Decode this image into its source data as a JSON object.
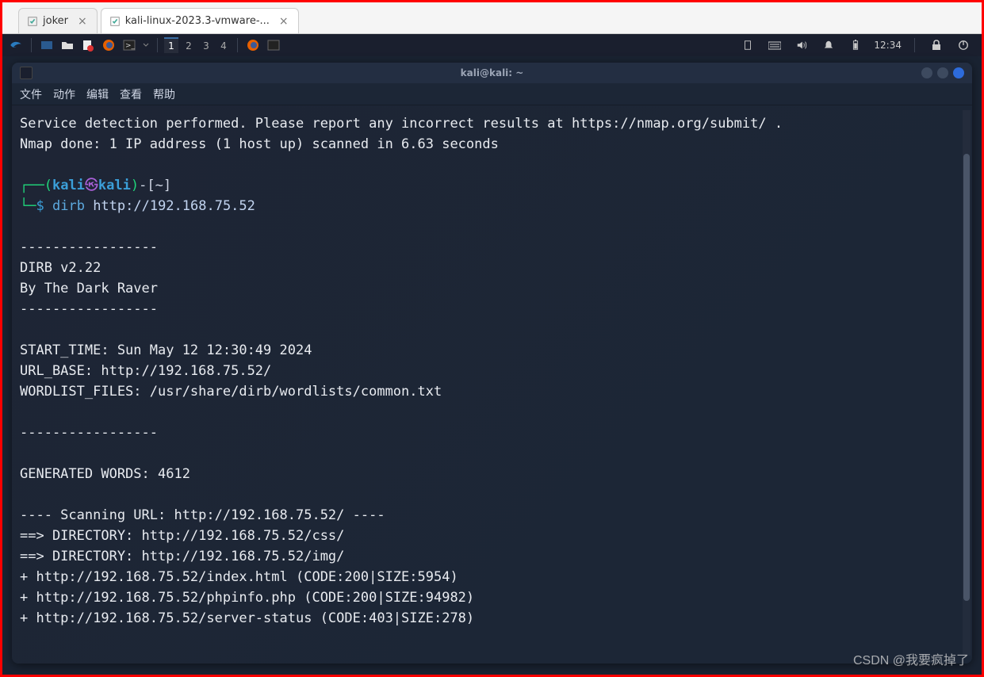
{
  "outer_tabs": [
    {
      "label": "joker",
      "active": false
    },
    {
      "label": "kali-linux-2023.3-vmware-...",
      "active": true
    }
  ],
  "taskbar": {
    "workspaces": [
      "1",
      "2",
      "3",
      "4"
    ],
    "active_workspace": 0,
    "clock": "12:34"
  },
  "terminal": {
    "title": "kali@kali: ~",
    "menu": {
      "file": "文件",
      "action": "动作",
      "edit": "编辑",
      "view": "查看",
      "help": "帮助"
    },
    "prompt": {
      "user": "kali",
      "host": "kali",
      "path": "~",
      "symbol": "$",
      "dash": "-",
      "l1": "┌──",
      "l2": "└─"
    },
    "command": {
      "name": "dirb",
      "arg": "http://192.168.75.52"
    },
    "lines": {
      "svc": "Service detection performed. Please report any incorrect results at https://nmap.org/submit/ .",
      "nmap": "Nmap done: 1 IP address (1 host up) scanned in 6.63 seconds",
      "dash1": "-----------------",
      "ver": "DIRB v2.22",
      "by": "By The Dark Raver",
      "dash2": "-----------------",
      "start": "START_TIME: Sun May 12 12:30:49 2024",
      "urlbase": "URL_BASE: http://192.168.75.52/",
      "wordlist": "WORDLIST_FILES: /usr/share/dirb/wordlists/common.txt",
      "dash3": "-----------------",
      "genwords": "GENERATED WORDS: 4612",
      "scanhdr": "---- Scanning URL: http://192.168.75.52/ ----",
      "dir1": "==> DIRECTORY: http://192.168.75.52/css/",
      "dir2": "==> DIRECTORY: http://192.168.75.52/img/",
      "hit1": "+ http://192.168.75.52/index.html (CODE:200|SIZE:5954)",
      "hit2": "+ http://192.168.75.52/phpinfo.php (CODE:200|SIZE:94982)",
      "hit3": "+ http://192.168.75.52/server-status (CODE:403|SIZE:278)"
    }
  },
  "watermark": "CSDN @我要疯掉了"
}
